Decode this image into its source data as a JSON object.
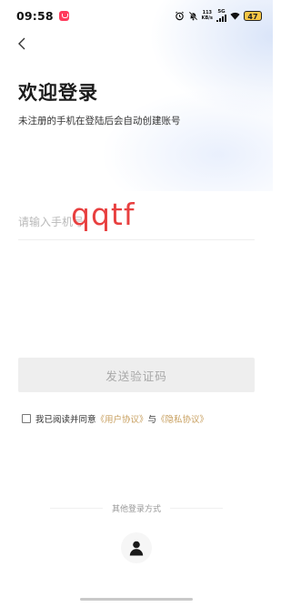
{
  "status_bar": {
    "time": "09:58",
    "net_speed_value": "113",
    "net_speed_unit": "KB/s",
    "signal_label": "5G",
    "battery": "47",
    "icons": [
      "app-notification-icon",
      "alarm-icon",
      "mute-icon",
      "net-speed",
      "signal-icon",
      "wifi-icon",
      "battery-icon"
    ]
  },
  "header": {
    "back_icon": "chevron-left-icon",
    "title": "欢迎登录",
    "subtitle": "未注册的手机在登陆后会自动创建账号"
  },
  "form": {
    "phone_placeholder": "请输入手机号",
    "phone_value": "",
    "scribble_text": "qqtf",
    "send_code_label": "发送验证码"
  },
  "agreement": {
    "checked": false,
    "prefix": "我已阅读并同意",
    "user_agreement": "《用户协议》",
    "conjunction": "与",
    "privacy_policy": "《隐私协议》"
  },
  "other_login": {
    "label": "其他登录方式",
    "options": [
      {
        "icon": "user-icon"
      }
    ]
  },
  "colors": {
    "link": "#c8a060",
    "button_bg": "#eeeeee",
    "button_text": "#a8a8a8",
    "scribble": "#e84040",
    "battery": "#f6c646"
  }
}
